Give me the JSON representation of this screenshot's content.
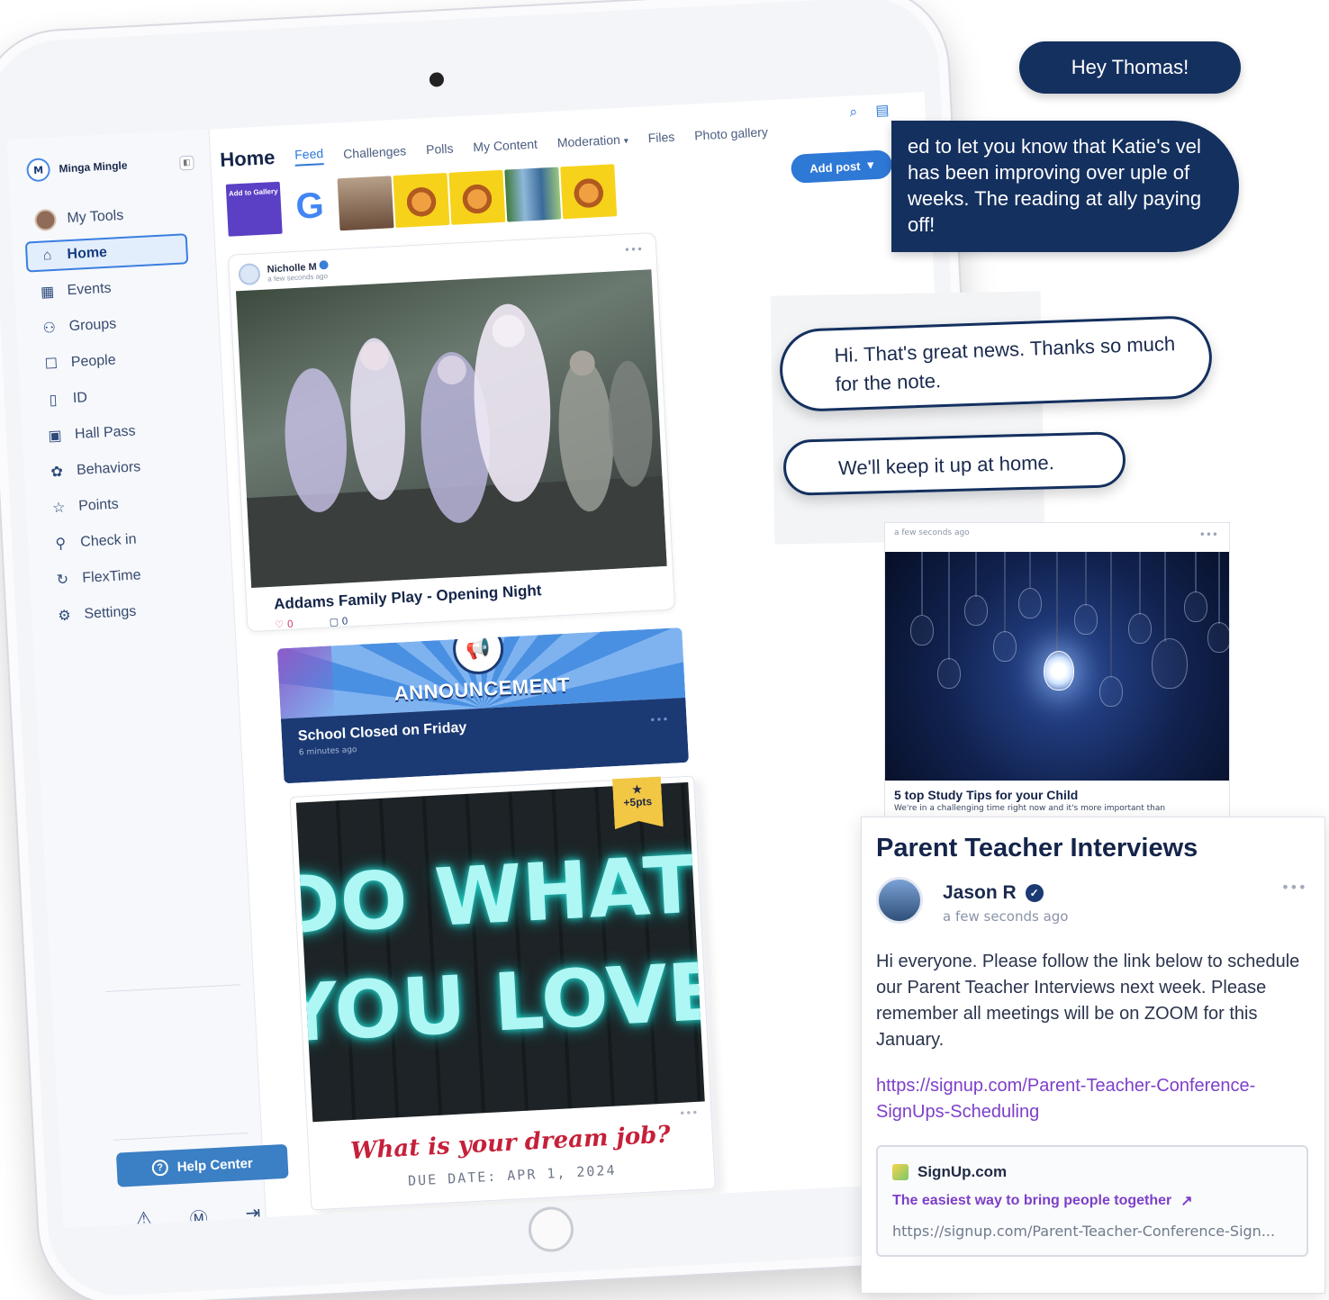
{
  "sidebar": {
    "brand": "Minga Mingle",
    "logo_letter": "M",
    "items": [
      {
        "label": "My Tools",
        "icon": "avatar"
      },
      {
        "label": "Home",
        "icon": "home-icon",
        "active": true
      },
      {
        "label": "Events",
        "icon": "calendar-icon"
      },
      {
        "label": "Groups",
        "icon": "groups-icon"
      },
      {
        "label": "People",
        "icon": "people-icon"
      },
      {
        "label": "ID",
        "icon": "id-icon"
      },
      {
        "label": "Hall Pass",
        "icon": "hall-pass-icon"
      },
      {
        "label": "Behaviors",
        "icon": "behaviors-icon"
      },
      {
        "label": "Points",
        "icon": "star-icon"
      },
      {
        "label": "Check in",
        "icon": "checkin-icon"
      },
      {
        "label": "FlexTime",
        "icon": "flextime-icon"
      },
      {
        "label": "Settings",
        "icon": "gear-icon"
      }
    ],
    "help_center": "Help Center"
  },
  "header": {
    "title": "Home",
    "tabs": [
      {
        "label": "Feed",
        "active": true
      },
      {
        "label": "Challenges"
      },
      {
        "label": "Polls"
      },
      {
        "label": "My Content"
      },
      {
        "label": "Moderation",
        "dropdown": true
      },
      {
        "label": "Files"
      },
      {
        "label": "Photo gallery"
      }
    ],
    "add_post": "Add post"
  },
  "gallery": {
    "add_label": "Add to Gallery",
    "google_letter": "G"
  },
  "post": {
    "author": "Nicholle M",
    "time": "a few seconds ago",
    "title": "Addams Family Play - Opening Night",
    "likes": "0",
    "comments": "0"
  },
  "announcement": {
    "label": "ANNOUNCEMENT",
    "title": "School Closed on Friday",
    "time": "6 minutes ago"
  },
  "challenge": {
    "image_line1": "DO WHAT",
    "image_line2": "YOU LOVE",
    "points": "+5pts",
    "question": "What is your dream job?",
    "due": "DUE DATE: APR 1, 2024"
  },
  "chat": {
    "msg1": "Hey Thomas!",
    "msg2": "ed to let you know that Katie's vel has been improving over uple of weeks. The reading at ally paying off!",
    "reply1": "Hi. That's great news. Thanks so much for the note.",
    "reply2": "We'll keep it up at home."
  },
  "tips": {
    "time": "a few seconds ago",
    "title": "5 top Study Tips for your Child",
    "desc": "We're in a challenging time right now and it's more important than"
  },
  "interviews": {
    "title": "Parent Teacher Interviews",
    "author": "Jason R",
    "time": "a few seconds ago",
    "body": "Hi everyone. Please follow the link below to schedule our Parent Teacher Interviews next week. Please remember all meetings will be on ZOOM for this January.",
    "link": "https://signup.com/Parent-Teacher-Conference-SignUps-Scheduling",
    "preview_site": "SignUp.com",
    "preview_tagline": "The easiest way to bring people together",
    "preview_url": "https://signup.com/Parent-Teacher-Conference-Sign..."
  }
}
